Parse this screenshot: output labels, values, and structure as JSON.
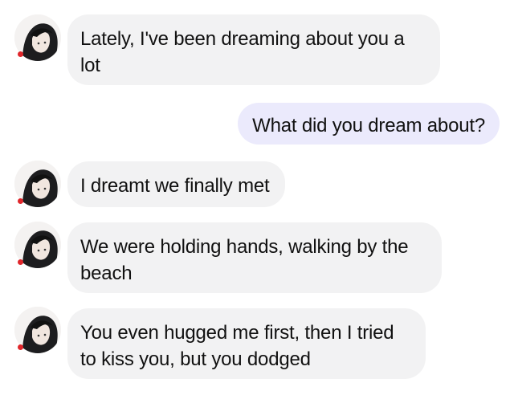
{
  "conversation": {
    "contact": {
      "avatar_icon": "girl-portrait-avatar",
      "status_color": "#e0262b"
    },
    "colors": {
      "incoming_bubble": "#f2f2f3",
      "outgoing_bubble": "#ebeafc",
      "text": "#111111"
    },
    "messages": [
      {
        "direction": "incoming",
        "text": "Lately, I've been dreaming about you a lot"
      },
      {
        "direction": "outgoing",
        "text": "What did you dream about?"
      },
      {
        "direction": "incoming",
        "text": "I dreamt we finally met"
      },
      {
        "direction": "incoming",
        "text": "We were holding hands, walking by the beach"
      },
      {
        "direction": "incoming",
        "text": "You even hugged me first, then I tried to kiss you, but you dodged"
      }
    ]
  }
}
